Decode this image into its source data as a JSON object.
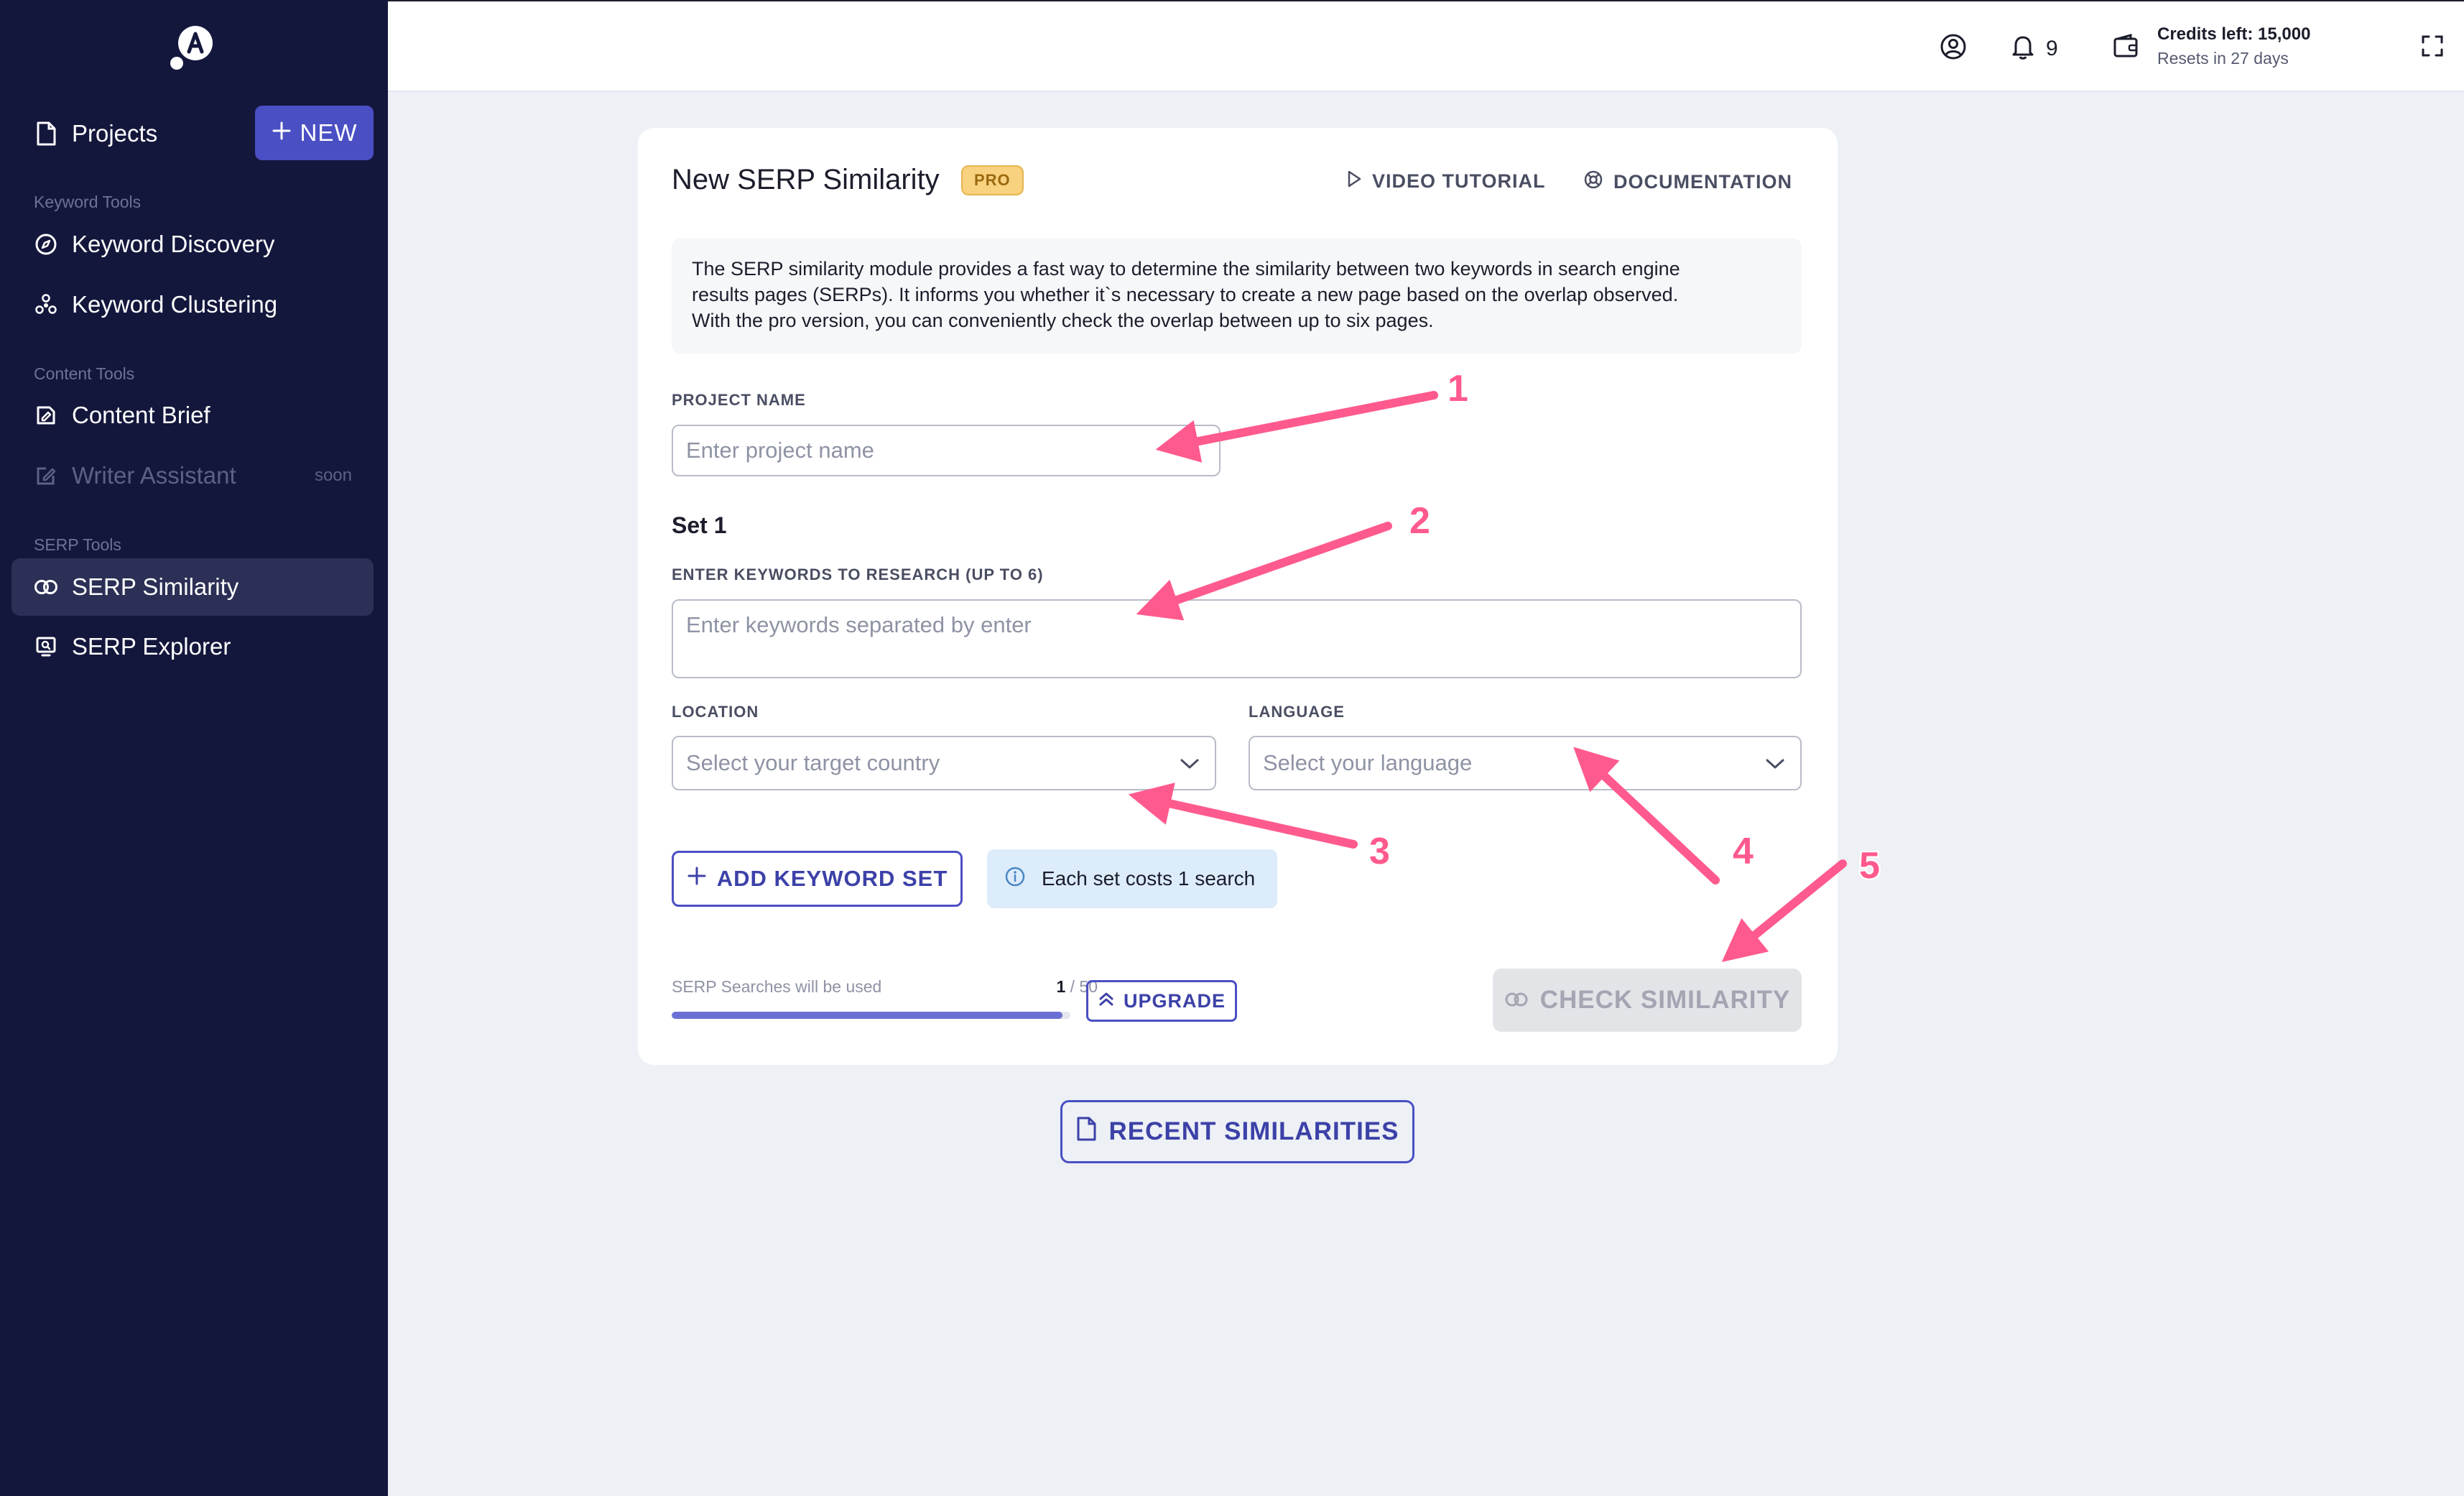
{
  "sidebar": {
    "projects_label": "Projects",
    "new_label": "NEW",
    "sections": {
      "keyword": "Keyword Tools",
      "content": "Content Tools",
      "serp": "SERP Tools"
    },
    "items": {
      "keyword_discovery": "Keyword Discovery",
      "keyword_clustering": "Keyword Clustering",
      "content_brief": "Content Brief",
      "writer_assistant": "Writer Assistant",
      "writer_soon": "soon",
      "serp_similarity": "SERP Similarity",
      "serp_explorer": "SERP Explorer"
    }
  },
  "topbar": {
    "notifications_count": "9",
    "credits_left": "Credits left: 15,000",
    "resets": "Resets in 27 days"
  },
  "card": {
    "title": "New SERP Similarity",
    "pro_badge": "PRO",
    "video_tutorial": "VIDEO TUTORIAL",
    "documentation": "DOCUMENTATION",
    "description_lines": [
      "The SERP similarity module provides a fast way to determine the similarity between two keywords in search engine",
      "results pages (SERPs). It informs you whether it`s necessary to create a new page based on the overlap observed.",
      "With the pro version, you can conveniently check the overlap between up to six pages."
    ],
    "project_name_label": "PROJECT NAME",
    "project_name_placeholder": "Enter project name",
    "set_title": "Set 1",
    "keywords_label": "ENTER KEYWORDS TO RESEARCH (UP TO 6)",
    "keywords_placeholder": "Enter keywords separated by enter",
    "location_label": "LOCATION",
    "location_placeholder": "Select your target country",
    "language_label": "LANGUAGE",
    "language_placeholder": "Select your language",
    "add_keyword_set": "ADD KEYWORD SET",
    "set_cost": "Each set costs 1 search",
    "usage_label": "SERP Searches will be used",
    "usage_used": "1",
    "usage_total": "/ 50",
    "usage_fraction": 0.98,
    "upgrade": "UPGRADE",
    "check_similarity": "CHECK SIMILARITY"
  },
  "recent_similarities": "RECENT SIMILARITIES",
  "annotations": [
    "1",
    "2",
    "3",
    "4",
    "5"
  ],
  "colors": {
    "sidebar_bg": "#14173c",
    "accent": "#4a4fc4",
    "annotation": "#ff5a8d",
    "pro_badge": "#f9d27f"
  }
}
